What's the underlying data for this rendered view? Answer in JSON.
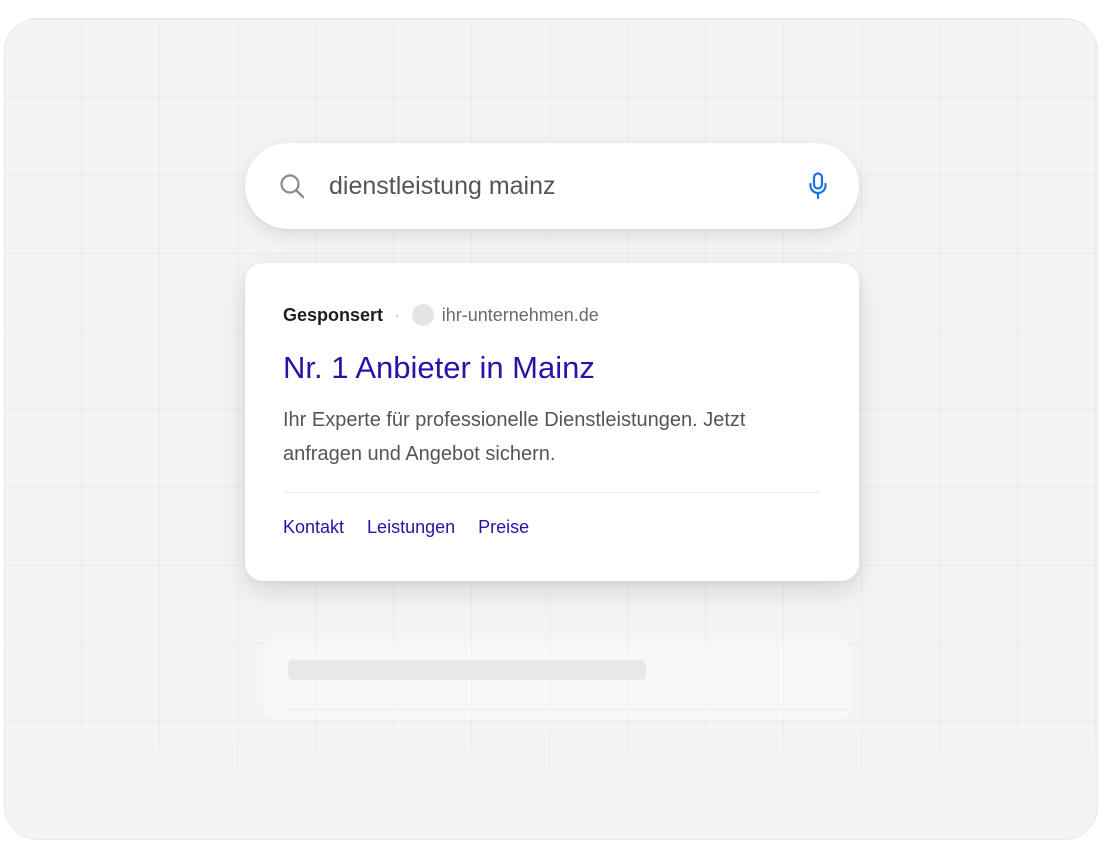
{
  "search": {
    "query": "dienstleistung mainz",
    "search_icon": "search-icon",
    "mic_icon": "mic-icon",
    "accent_color": "#1a73e8"
  },
  "ad": {
    "sponsored_label": "Gesponsert",
    "separator": "·",
    "domain": "ihr-unternehmen.de",
    "title": "Nr. 1 Anbieter in Mainz",
    "description": "Ihr Experte für professionelle Dienstleistungen. Jetzt anfragen und Angebot sichern.",
    "links": [
      "Kontakt",
      "Leistungen",
      "Preise"
    ],
    "link_color": "#2a12a8"
  }
}
